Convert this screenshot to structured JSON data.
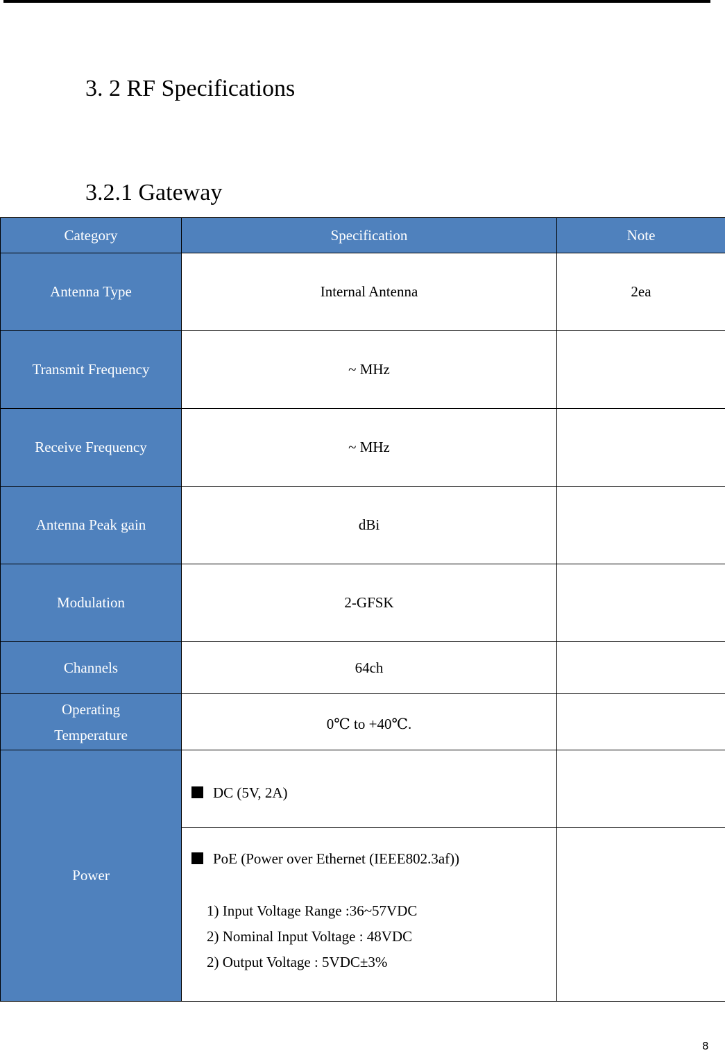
{
  "headings": {
    "section": "3. 2 RF Specifications",
    "subsection": "3.2.1 Gateway"
  },
  "table": {
    "columns": [
      "Category",
      "Specification",
      "Note"
    ],
    "rows": [
      {
        "category": "Antenna Type",
        "spec": "Internal Antenna",
        "note": "2ea"
      },
      {
        "category": "Transmit Frequency",
        "spec": "~ MHz",
        "note": ""
      },
      {
        "category": "Receive Frequency",
        "spec": "~ MHz",
        "note": ""
      },
      {
        "category": "Antenna Peak gain",
        "spec": "dBi",
        "note": ""
      },
      {
        "category": "Modulation",
        "spec": "2-GFSK",
        "note": ""
      },
      {
        "category": "Channels",
        "spec": "64ch",
        "note": ""
      },
      {
        "category_line1": "Operating",
        "category_line2": "Temperature",
        "spec": "0℃ to +40℃.",
        "note": ""
      }
    ],
    "power": {
      "category": "Power",
      "dc": "DC (5V, 2A)",
      "poe": "PoE (Power over Ethernet (IEEE802.3af))",
      "poe_items": [
        "1) Input Voltage Range :36~57VDC",
        "2) Nominal Input Voltage : 48VDC",
        "2) Output Voltage : 5VDC±3%"
      ]
    }
  },
  "colors": {
    "header_blue": "#4f81bd"
  },
  "page_number": "8"
}
